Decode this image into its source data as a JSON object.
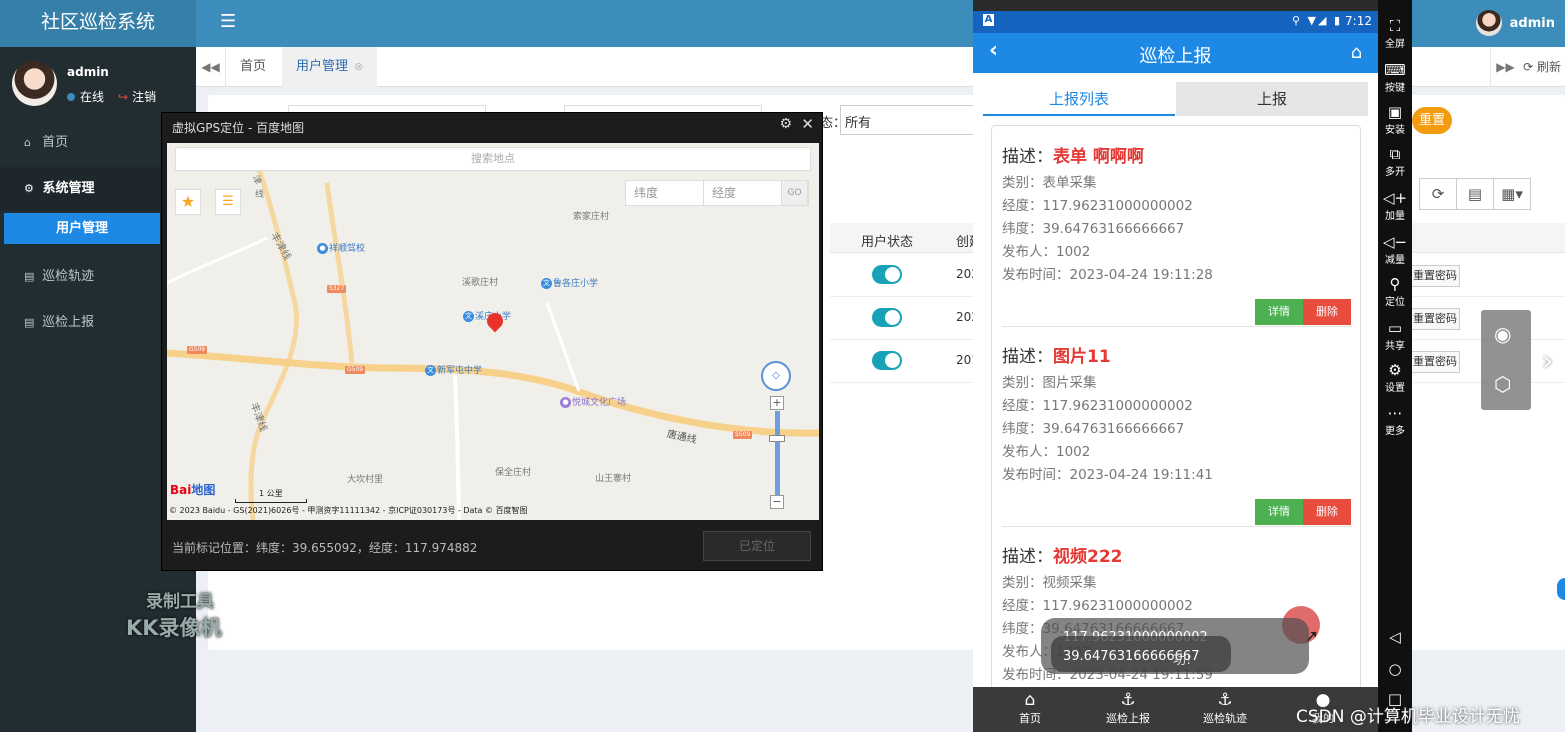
{
  "admin": {
    "app_title": "社区巡检系统",
    "top_user": "admin",
    "user_name": "admin",
    "online": "在线",
    "logout": "注销",
    "menu": [
      {
        "label": "首页"
      },
      {
        "label": "系统管理"
      },
      {
        "label": "巡检轨迹"
      },
      {
        "label": "巡检上报"
      }
    ],
    "submenu_active": "用户管理",
    "tabs": [
      "首页",
      "用户管理"
    ],
    "refresh": "刷新",
    "filter_value": "所有",
    "filter_label_tail": "态：",
    "reset": "重置",
    "table_headers": {
      "status": "用户状态",
      "created": "创建"
    },
    "rows": [
      {
        "date": "202",
        "reset_pwd": "重置密码"
      },
      {
        "date": "202",
        "reset_pwd": "重置密码"
      },
      {
        "date": "201",
        "reset_pwd": "重置密码"
      }
    ],
    "watermark_l1": "录制工具",
    "watermark_l2": "KK录像机"
  },
  "gps": {
    "title": "虚拟GPS定位 - 百度地图",
    "search_placeholder": "搜索地点",
    "lat_placeholder": "纬度",
    "lng_placeholder": "经度",
    "go": "GO",
    "places": {
      "rd_left": "津",
      "rd_left2": "线",
      "rd_fengjin": "丰津线",
      "suojia": "索家庄村",
      "xiangshun": "祥顺驾校",
      "xiexin": "溪歌庄村",
      "luge": "鲁各庄小学",
      "school": "溪庄小学",
      "xinjun": "新军屯中学",
      "yuecheng": "悦城文化广场",
      "fengjin2": "丰津线",
      "tangtong": "唐通线",
      "dakan": "大坎村里",
      "baoquan": "保全庄村",
      "shanwang": "山王寨村",
      "g509": "G509",
      "s327": "S327",
      "s509b": "G509",
      "s509c": "S509"
    },
    "scale": "1 公里",
    "baidu_logo_a": "Bai",
    "baidu_logo_b": "地图",
    "copyright": "© 2023 Baidu - GS(2021)6026号 - 甲测资字11111342 - 京ICP证030173号 - Data © 百度智图",
    "current": "当前标记位置：纬度：39.655092，经度：117.974882",
    "located": "已定位"
  },
  "phone": {
    "time": "7:12",
    "title": "巡检上报",
    "tab_list": "上报列表",
    "tab_report": "上报",
    "desc_label": "描述：",
    "cards": [
      {
        "desc": "表单 啊啊啊",
        "category": "类别：表单采集",
        "lng": "经度：117.96231000000002",
        "lat": "纬度：39.64763166666667",
        "publisher": "发布人：1002",
        "time": "发布时间：2023-04-24 19:11:28"
      },
      {
        "desc": "图片11",
        "category": "类别：图片采集",
        "lng": "经度：117.96231000000002",
        "lat": "纬度：39.64763166666667",
        "publisher": "发布人：1002",
        "time": "发布时间：2023-04-24 19:11:41"
      },
      {
        "desc": "视频222",
        "category": "类别：视频采集",
        "lng": "经度：117.96231000000002",
        "lat": "纬度：39.64763166666667",
        "publisher": "发布人：1002",
        "time": "发布时间：2023-04-24 19:11:59"
      }
    ],
    "btn_detail": "详情",
    "btn_delete": "删除",
    "toast_l1": "117.96231000000002",
    "toast_l2": "39.64763166666667",
    "toast_l3": "功!",
    "nav": [
      {
        "label": "首页"
      },
      {
        "label": "巡检上报"
      },
      {
        "label": "巡检轨迹"
      },
      {
        "label": "我的"
      }
    ]
  },
  "emulator": {
    "side": [
      {
        "label": "全屏"
      },
      {
        "label": "按键"
      },
      {
        "label": "安装"
      },
      {
        "label": "多开"
      },
      {
        "label": "加量"
      },
      {
        "label": "减量"
      },
      {
        "label": "定位"
      },
      {
        "label": "共享"
      },
      {
        "label": "设置"
      },
      {
        "label": "更多"
      }
    ]
  },
  "csdn_watermark": "CSDN @计算机毕业设计无忧"
}
